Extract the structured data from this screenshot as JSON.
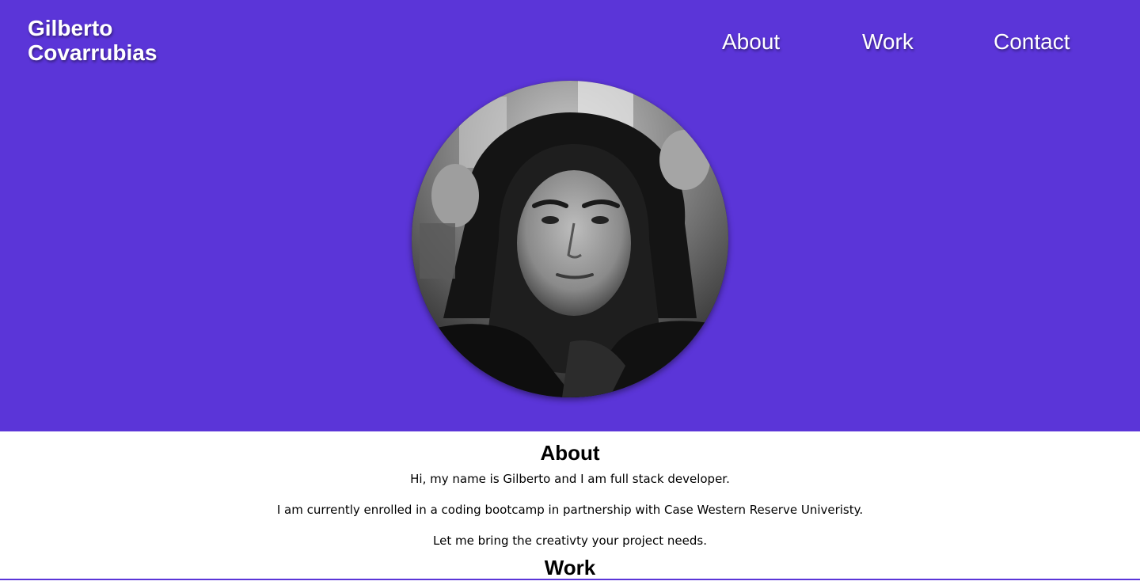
{
  "header": {
    "brand_line1": "Gilberto",
    "brand_line2": "Covarrubias",
    "nav": [
      {
        "label": "About"
      },
      {
        "label": "Work"
      },
      {
        "label": "Contact"
      }
    ]
  },
  "about": {
    "heading": "About",
    "paragraphs": [
      "Hi, my name is Gilberto and I am full stack developer.",
      "I am currently enrolled in a coding bootcamp in partnership with Case Western Reserve Univeristy.",
      "Let me bring the creativty your project needs."
    ]
  },
  "work": {
    "heading": "Work"
  },
  "colors": {
    "accent": "#5b35d8",
    "text_light": "#ffffff",
    "text_dark": "#000000"
  }
}
